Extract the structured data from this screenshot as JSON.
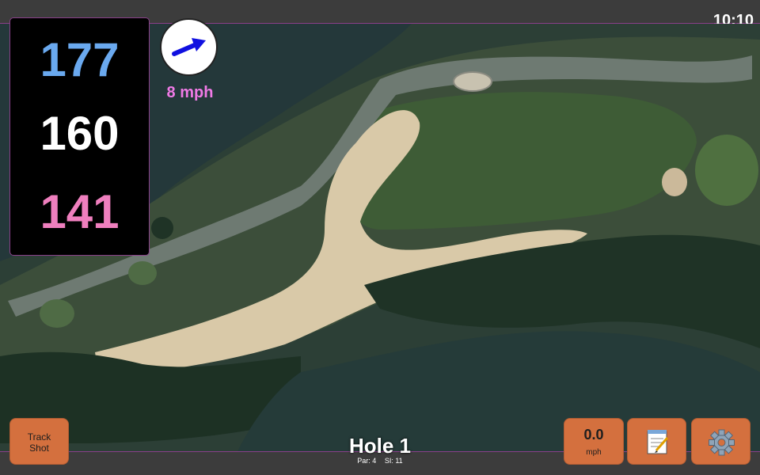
{
  "clock": "10:10",
  "distances": {
    "back": "177",
    "middle": "160",
    "front": "141"
  },
  "wind": {
    "speed_label": "8 mph",
    "arrow_icon": "arrow-right-icon"
  },
  "hole": {
    "title": "Hole 1",
    "par_label": "Par: 4",
    "si_label": "SI: 11"
  },
  "buttons": {
    "track_shot_line1": "Track",
    "track_shot_line2": "Shot",
    "wind_value": "0.0",
    "wind_unit": "mph",
    "notes_icon": "notepad-icon",
    "settings_icon": "gear-icon"
  },
  "colors": {
    "back": "#6aa9ef",
    "middle": "#ffffff",
    "front": "#ef7fbe",
    "wind_text": "#f07ae6",
    "button": "#d4703e",
    "accent_border": "#8a3f8a"
  }
}
